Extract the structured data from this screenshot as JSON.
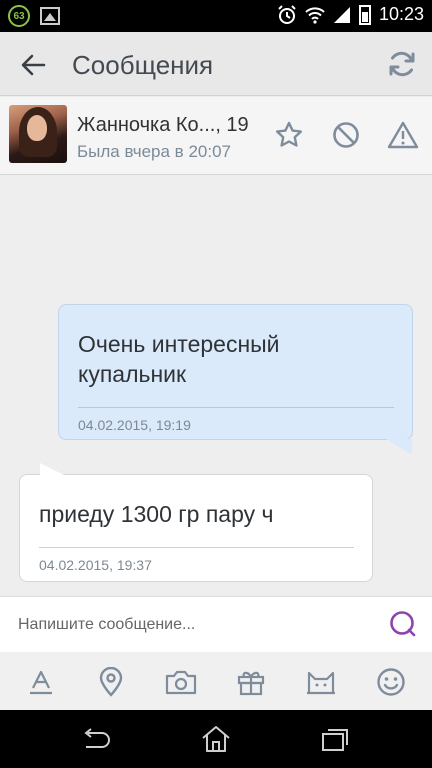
{
  "status_bar": {
    "notification_count": "63",
    "time": "10:23"
  },
  "app_bar": {
    "title": "Сообщения"
  },
  "contact": {
    "name": "Жанночка Ко..., 19",
    "status": "Была вчера в 20:07"
  },
  "messages": [
    {
      "direction": "outgoing",
      "text": "Очень интересный купальник",
      "timestamp": "04.02.2015, 19:19"
    },
    {
      "direction": "incoming",
      "text": "приеду 1300 гр пару ч",
      "timestamp": "04.02.2015, 19:37"
    }
  ],
  "composer": {
    "placeholder": "Напишите сообщение...",
    "value": ""
  },
  "toolbar": {
    "icons": [
      "text-format-icon",
      "location-icon",
      "camera-icon",
      "gift-icon",
      "sticker-cat-icon",
      "smiley-icon"
    ]
  },
  "colors": {
    "accent": "#8e44ad",
    "icon_gray": "#7e8c9b",
    "outgoing_bubble": "#dbeafa",
    "incoming_bubble": "#ffffff",
    "battery_green": "#8bc34a"
  }
}
